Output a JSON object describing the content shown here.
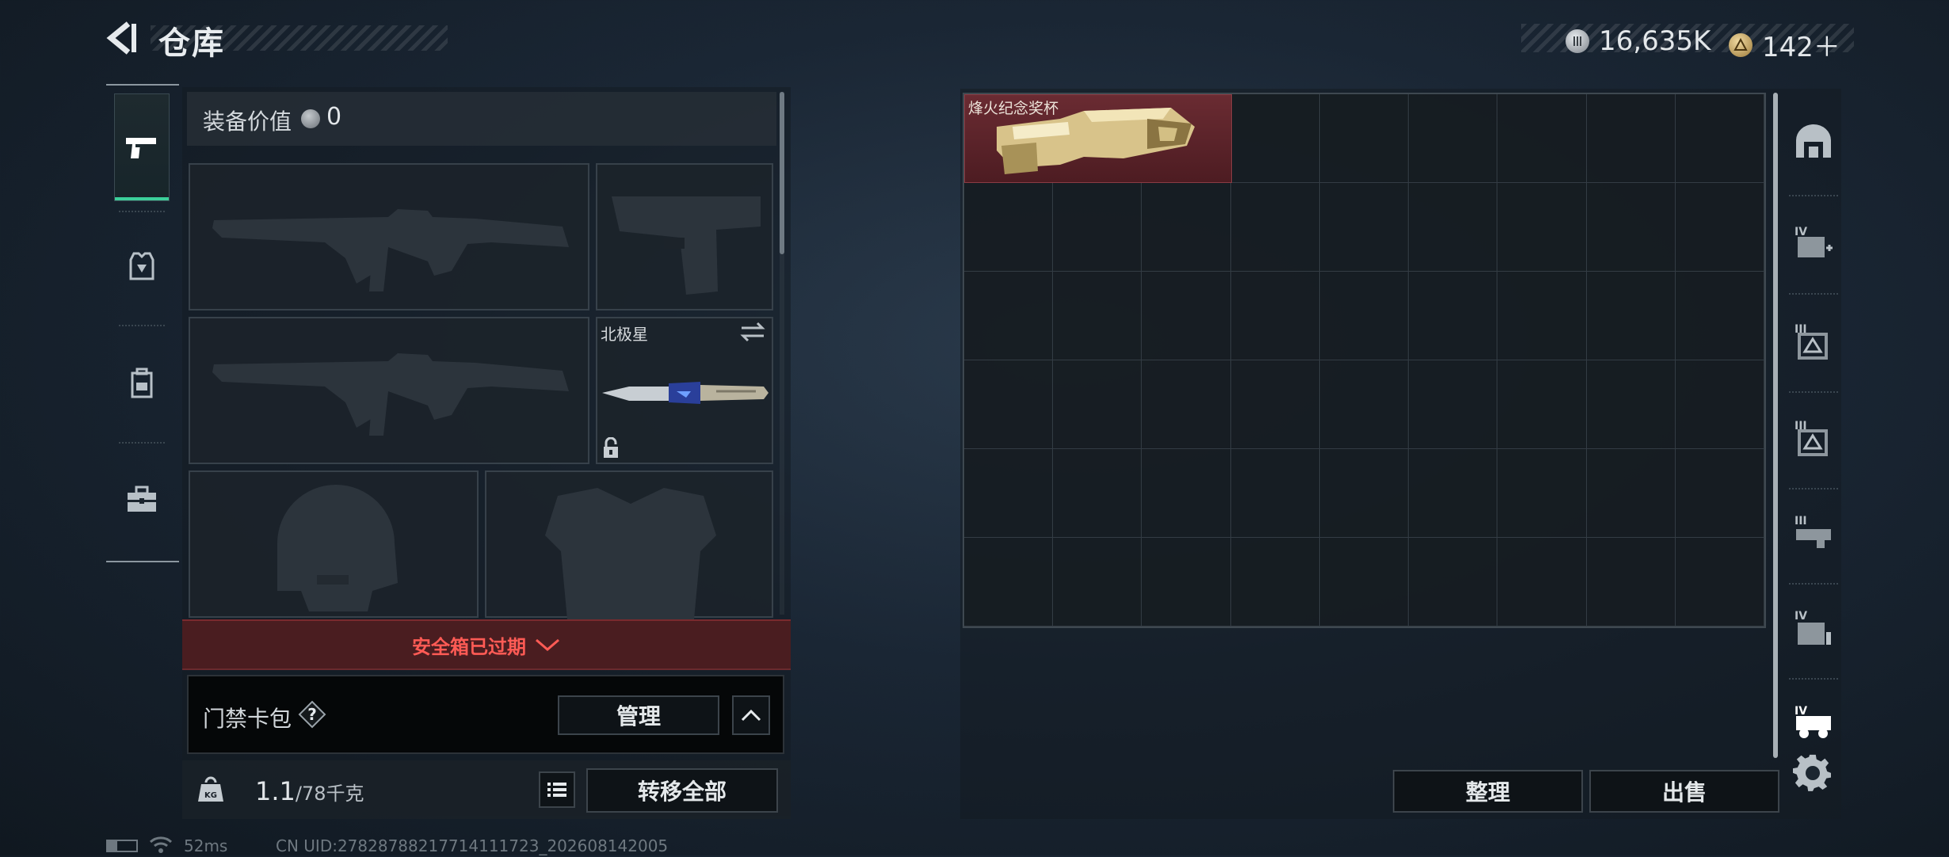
{
  "header": {
    "title": "仓库",
    "currency_silver": "16,635K",
    "currency_gold": "142＋"
  },
  "loadout": {
    "equipment_value_label": "装备价值",
    "equipment_value": "0",
    "melee_name": "北极星",
    "safebox_text": "安全箱已过期",
    "keycard_label": "门禁卡包",
    "manage_label": "管理",
    "weight_current": "1.1",
    "weight_max": "/78千克",
    "transfer_all_label": "转移全部"
  },
  "storage": {
    "item_name": "烽火纪念奖杯",
    "sort_label": "整理",
    "sell_label": "出售"
  },
  "status_bar": {
    "ping": "52ms",
    "uid": "CN UID:27828788217714111723_202608142005"
  },
  "colors": {
    "accent_green": "#3ccf9a",
    "expired_red": "#ff5b55",
    "item_highlight": "#6a2b32"
  }
}
